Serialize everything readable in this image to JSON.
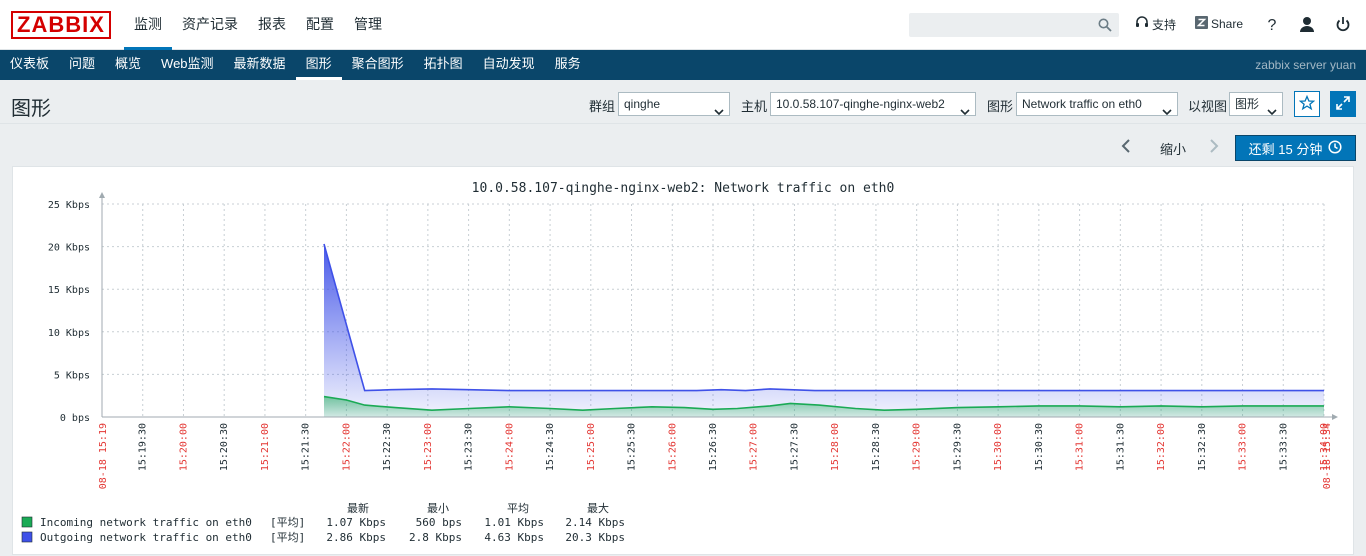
{
  "header": {
    "logo": "ZABBIX",
    "nav": [
      "监测",
      "资产记录",
      "报表",
      "配置",
      "管理"
    ],
    "active_nav": 0,
    "search_value": "",
    "support_label": "支持",
    "share_label": "Share",
    "help_icon": "question-icon",
    "user_icon": "user-icon",
    "logout_icon": "power-icon"
  },
  "subnav": {
    "items": [
      "仪表板",
      "问题",
      "概览",
      "Web监测",
      "最新数据",
      "图形",
      "聚合图形",
      "拓扑图",
      "自动发现",
      "服务"
    ],
    "active": 5,
    "server_name": "zabbix server yuan"
  },
  "page": {
    "title": "图形",
    "group_label": "群组",
    "group_value": "qinghe",
    "host_label": "主机",
    "host_value": "10.0.58.107-qinghe-nginx-web2",
    "graph_label": "图形",
    "graph_value": "Network traffic on eth0",
    "view_label": "以视图",
    "view_value": "图形"
  },
  "timebar": {
    "zoom_label": "缩小",
    "range_label": "还剩 15 分钟"
  },
  "colors": {
    "incoming": "#1aaa55",
    "outgoing": "#3f51e8",
    "accent": "#0275b8",
    "nav_bg": "#0a466a"
  },
  "chart_data": {
    "type": "area",
    "title": "10.0.58.107-qinghe-nginx-web2: Network traffic on eth0",
    "ylabel": "",
    "y_unit": "Kbps",
    "ylim": [
      0,
      25
    ],
    "y_ticks": [
      "0 bps",
      "5 Kbps",
      "10 Kbps",
      "15 Kbps",
      "20 Kbps",
      "25 Kbps"
    ],
    "x_start_label": "08-18 15:19",
    "x_end_label": "08-18 15:34",
    "x_ticks": [
      "15:19:30",
      "15:20:00",
      "15:20:30",
      "15:21:00",
      "15:21:30",
      "15:22:00",
      "15:22:30",
      "15:23:00",
      "15:23:30",
      "15:24:00",
      "15:24:30",
      "15:25:00",
      "15:25:30",
      "15:26:00",
      "15:26:30",
      "15:27:00",
      "15:27:30",
      "15:28:00",
      "15:28:30",
      "15:29:00",
      "15:29:30",
      "15:30:00",
      "15:30:30",
      "15:31:00",
      "15:31:30",
      "15:32:00",
      "15:32:30",
      "15:33:00",
      "15:33:30",
      "15:34:00"
    ],
    "series": [
      {
        "name": "Outgoing network traffic on eth0",
        "color": "#3f51e8",
        "points": [
          [
            5.45,
            20.3
          ],
          [
            6.45,
            3.1
          ],
          [
            7.1,
            3.2
          ],
          [
            8.1,
            3.3
          ],
          [
            9.0,
            3.2
          ],
          [
            10.0,
            3.1
          ],
          [
            11.0,
            3.1
          ],
          [
            12.0,
            3.1
          ],
          [
            13.0,
            3.1
          ],
          [
            14.0,
            3.1
          ],
          [
            14.6,
            3.1
          ],
          [
            15.2,
            3.2
          ],
          [
            15.8,
            3.1
          ],
          [
            16.4,
            3.3
          ],
          [
            16.9,
            3.2
          ],
          [
            17.5,
            3.1
          ],
          [
            18.5,
            3.1
          ],
          [
            19.5,
            3.1
          ],
          [
            20.5,
            3.1
          ],
          [
            21.5,
            3.1
          ],
          [
            22.5,
            3.1
          ],
          [
            23.5,
            3.1
          ],
          [
            24.5,
            3.1
          ],
          [
            25.5,
            3.1
          ],
          [
            26.5,
            3.1
          ],
          [
            27.5,
            3.1
          ],
          [
            28.5,
            3.1
          ],
          [
            29.5,
            3.1
          ],
          [
            30.0,
            3.1
          ]
        ]
      },
      {
        "name": "Incoming network traffic on eth0",
        "color": "#1aaa55",
        "points": [
          [
            5.45,
            2.4
          ],
          [
            6.0,
            2.0
          ],
          [
            6.45,
            1.4
          ],
          [
            7.2,
            1.1
          ],
          [
            8.1,
            0.8
          ],
          [
            9.0,
            1.0
          ],
          [
            10.0,
            1.2
          ],
          [
            11.0,
            1.0
          ],
          [
            11.8,
            0.8
          ],
          [
            12.6,
            1.0
          ],
          [
            13.5,
            1.2
          ],
          [
            14.3,
            1.1
          ],
          [
            15.0,
            0.9
          ],
          [
            15.6,
            1.0
          ],
          [
            16.4,
            1.3
          ],
          [
            16.9,
            1.6
          ],
          [
            17.6,
            1.4
          ],
          [
            18.5,
            1.0
          ],
          [
            19.2,
            0.8
          ],
          [
            20.0,
            0.9
          ],
          [
            21.0,
            1.1
          ],
          [
            22.0,
            1.2
          ],
          [
            23.0,
            1.3
          ],
          [
            24.0,
            1.3
          ],
          [
            25.0,
            1.2
          ],
          [
            26.0,
            1.3
          ],
          [
            27.0,
            1.2
          ],
          [
            28.0,
            1.3
          ],
          [
            29.0,
            1.3
          ],
          [
            30.0,
            1.3
          ]
        ]
      }
    ],
    "legend": {
      "headers": [
        "最新",
        "最小",
        "平均",
        "最大"
      ],
      "rows": [
        {
          "name": "Incoming network traffic on eth0",
          "func": "[平均]",
          "last": "1.07 Kbps",
          "min": "560 bps",
          "avg": "1.01 Kbps",
          "max": "2.14 Kbps",
          "color": "#1aaa55"
        },
        {
          "name": "Outgoing network traffic on eth0",
          "func": "[平均]",
          "last": "2.86 Kbps",
          "min": "2.8 Kbps",
          "avg": "4.63 Kbps",
          "max": "20.3 Kbps",
          "color": "#3f51e8"
        }
      ]
    },
    "grid": true,
    "legend_position": "bottom-left"
  }
}
